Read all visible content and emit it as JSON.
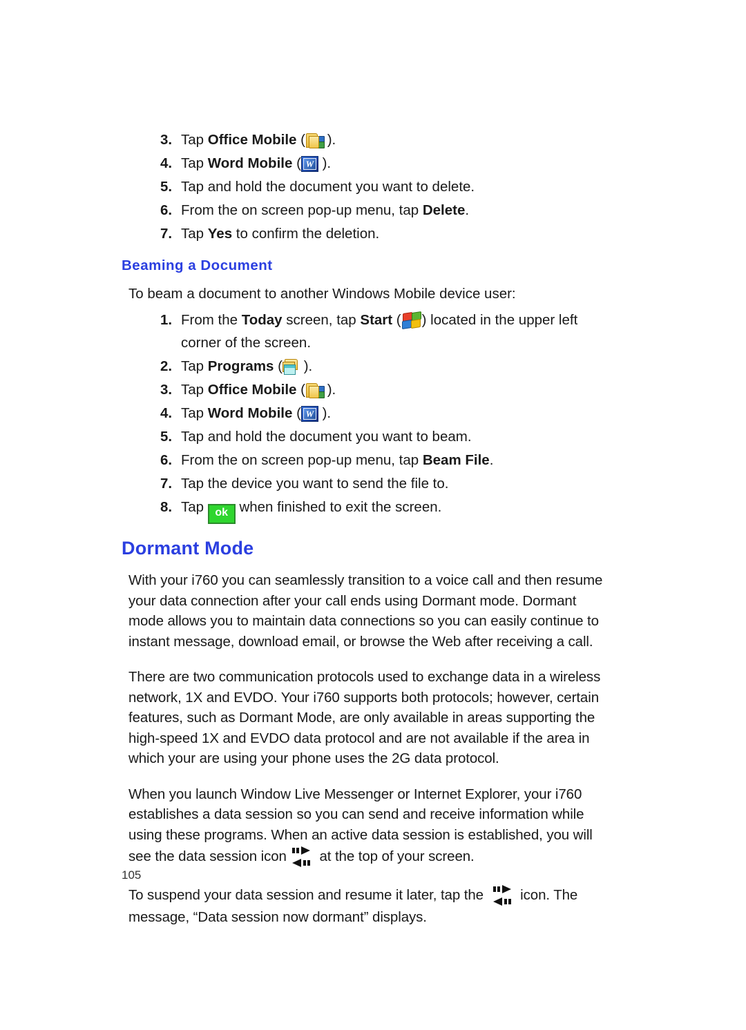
{
  "page": {
    "number": "105"
  },
  "icons": {
    "office_mobile": "office-mobile-folder-icon",
    "word_mobile": "word-mobile-icon",
    "start": "windows-start-flag-icon",
    "programs": "programs-folder-icon",
    "ok": "ok-button-icon",
    "ok_label": "ok",
    "word_letter": "W",
    "data_session": "data-session-arrows-icon"
  },
  "colors": {
    "heading_blue": "#2b3fe0",
    "body_text": "#1a1a1a",
    "ok_green": "#2fd62f",
    "ok_border_green": "#2a8b2a"
  },
  "delete_steps": [
    {
      "num": "3.",
      "pre": "Tap ",
      "bold": "Office Mobile",
      "mid": " (",
      "icon": "office_mobile",
      "post": " )."
    },
    {
      "num": "4.",
      "pre": "Tap ",
      "bold": "Word Mobile",
      "mid": " (",
      "icon": "word_mobile",
      "post": " )."
    },
    {
      "num": "5.",
      "pre": "Tap and hold the document you want to delete.",
      "bold": "",
      "mid": "",
      "icon": "",
      "post": ""
    },
    {
      "num": "6.",
      "pre": "From the on screen pop-up menu, tap ",
      "bold": "Delete",
      "mid": "",
      "icon": "",
      "post": "."
    },
    {
      "num": "7.",
      "pre": "Tap ",
      "bold": "Yes",
      "mid": " to confirm the deletion.",
      "icon": "",
      "post": ""
    }
  ],
  "beaming": {
    "heading": "Beaming a Document",
    "intro": "To beam a document to another Windows Mobile device user:",
    "steps": [
      {
        "num": "1.",
        "pre": "From the ",
        "bold": "Today",
        "mid": " screen, tap ",
        "bold2": "Start",
        "mid2": " (",
        "icon": "start",
        "post": ") located in the upper left corner of the screen."
      },
      {
        "num": "2.",
        "pre": "Tap ",
        "bold": "Programs",
        "mid": " (",
        "icon": "programs",
        "post": " )."
      },
      {
        "num": "3.",
        "pre": "Tap ",
        "bold": "Office Mobile",
        "mid": " (",
        "icon": "office_mobile",
        "post": " )."
      },
      {
        "num": "4.",
        "pre": "Tap ",
        "bold": "Word Mobile",
        "mid": " (",
        "icon": "word_mobile",
        "post": " )."
      },
      {
        "num": "5.",
        "pre": "Tap and hold the document you want to beam.",
        "bold": "",
        "mid": "",
        "icon": "",
        "post": ""
      },
      {
        "num": "6.",
        "pre": "From the on screen pop-up menu, tap ",
        "bold": "Beam File",
        "mid": "",
        "icon": "",
        "post": "."
      },
      {
        "num": "7.",
        "pre": "Tap the device you want to send the file to.",
        "bold": "",
        "mid": "",
        "icon": "",
        "post": ""
      },
      {
        "num": "8.",
        "pre": "Tap ",
        "bold": "",
        "mid": "",
        "icon": "ok",
        "post": " when finished to exit the screen."
      }
    ]
  },
  "dormant": {
    "heading": "Dormant Mode",
    "paragraph1": "With your i760 you can seamlessly transition to a voice call and then resume your data connection after your call ends using Dormant mode. Dormant mode allows you to maintain data connections so you can easily continue to instant message, download email, or browse the Web after receiving a call.",
    "paragraph2": "There are two communication protocols used to exchange data in a wireless network, 1X and EVDO. Your i760 supports both protocols; however, certain features, such as Dormant Mode, are only available in areas supporting the high-speed 1X and EVDO data protocol and are not available if the area in which your are using your phone uses the 2G data protocol.",
    "paragraph3_a": "When you launch Window Live Messenger or Internet Explorer, your i760 establishes a data session so you can send and receive information while using these programs. When an active data session is established, you will see the data session icon",
    "paragraph3_b": "at the top of your screen.",
    "paragraph4_a": "To suspend your data session and resume it later, tap the",
    "paragraph4_b": "icon. The message, “Data session now dormant” displays."
  }
}
